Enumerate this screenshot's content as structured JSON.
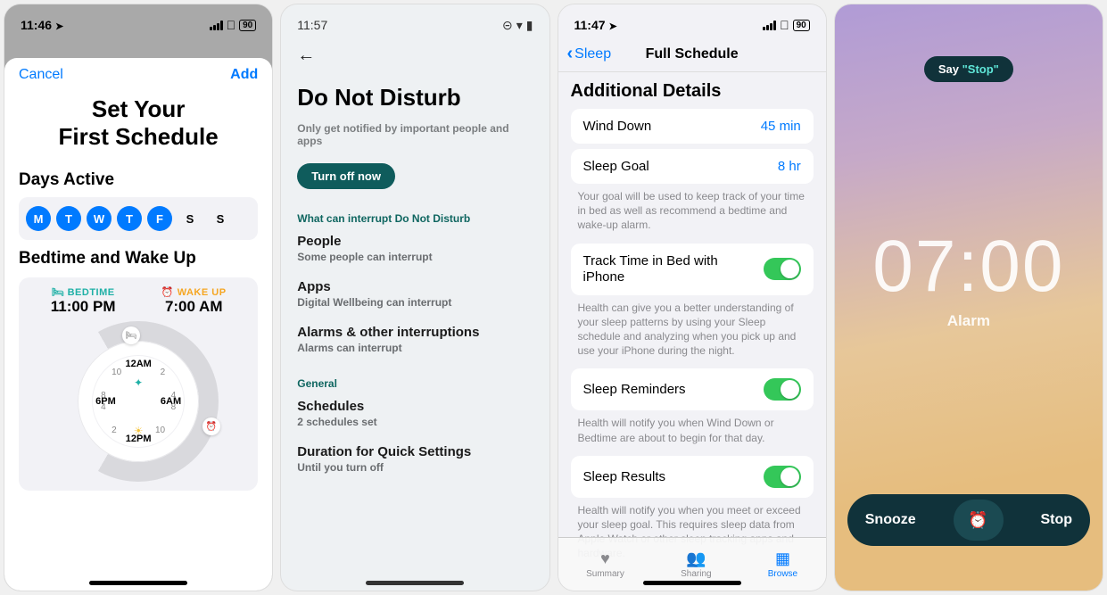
{
  "phone1": {
    "status": {
      "time": "11:46",
      "location_arrow": "➤",
      "battery": "90"
    },
    "nav": {
      "cancel": "Cancel",
      "add": "Add"
    },
    "title_line1": "Set Your",
    "title_line2": "First Schedule",
    "days_label": "Days Active",
    "days": [
      {
        "letter": "M",
        "active": true
      },
      {
        "letter": "T",
        "active": true
      },
      {
        "letter": "W",
        "active": true
      },
      {
        "letter": "T",
        "active": true
      },
      {
        "letter": "F",
        "active": true
      },
      {
        "letter": "S",
        "active": false
      },
      {
        "letter": "S",
        "active": false
      }
    ],
    "bw_label": "Bedtime and Wake Up",
    "bedtime_label": "BEDTIME",
    "bedtime_value": "11:00 PM",
    "wakeup_label": "WAKE UP",
    "wakeup_value": "7:00 AM",
    "clock_labels": {
      "top": "12AM",
      "right": "6AM",
      "bottom": "12PM",
      "left": "6PM",
      "n1": "10",
      "n2": "2",
      "n3": "4",
      "n4": "8",
      "n5": "8",
      "n6": "4",
      "n7": "2",
      "n8": "10"
    }
  },
  "phone2": {
    "status": {
      "time": "11:57"
    },
    "title": "Do Not Disturb",
    "subtitle": "Only get notified by important people and apps",
    "button": "Turn off now",
    "group1_label": "What can interrupt Do Not Disturb",
    "rows": [
      {
        "title": "People",
        "sub": "Some people can interrupt"
      },
      {
        "title": "Apps",
        "sub": "Digital Wellbeing can interrupt"
      },
      {
        "title": "Alarms & other interruptions",
        "sub": "Alarms can interrupt"
      }
    ],
    "group2_label": "General",
    "rows2": [
      {
        "title": "Schedules",
        "sub": "2 schedules set"
      },
      {
        "title": "Duration for Quick Settings",
        "sub": "Until you turn off"
      }
    ]
  },
  "phone3": {
    "status": {
      "time": "11:47",
      "battery": "90"
    },
    "back": "Sleep",
    "title": "Full Schedule",
    "section": "Additional Details",
    "winddown": {
      "label": "Wind Down",
      "value": "45 min"
    },
    "sleepgoal": {
      "label": "Sleep Goal",
      "value": "8 hr",
      "note": "Your goal will be used to keep track of your time in bed as well as recommend a bedtime and wake-up alarm."
    },
    "track": {
      "label": "Track Time in Bed with iPhone",
      "on": true,
      "note": "Health can give you a better understanding of your sleep patterns by using your Sleep schedule and analyzing when you pick up and use your iPhone during the night."
    },
    "reminders": {
      "label": "Sleep Reminders",
      "on": true,
      "note": "Health will notify you when Wind Down or Bedtime are about to begin for that day."
    },
    "results": {
      "label": "Sleep Results",
      "on": true,
      "note": "Health will notify you when you meet or exceed your sleep goal. This requires sleep data from Apple Watch or other sleep tracking apps and hardware."
    },
    "tabs": {
      "summary": "Summary",
      "sharing": "Sharing",
      "browse": "Browse"
    }
  },
  "phone4": {
    "hint_prefix": "Say ",
    "hint_quote": "\"Stop\"",
    "time": "07:00",
    "label": "Alarm",
    "snooze": "Snooze",
    "stop": "Stop"
  }
}
